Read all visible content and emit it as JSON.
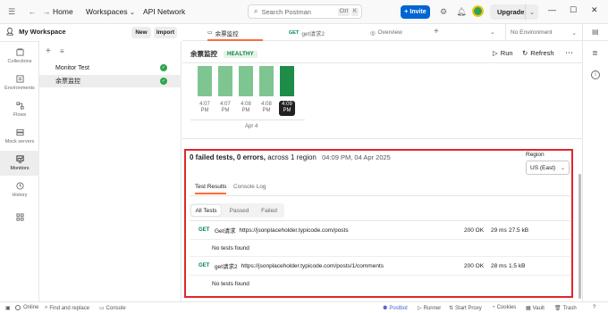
{
  "topbar": {
    "home": "Home",
    "workspaces": "Workspaces",
    "api_network": "API Network",
    "search_placeholder": "Search Postman",
    "kbd1": "Ctrl",
    "kbd2": "K",
    "invite": "Invite",
    "upgrade": "Upgrade"
  },
  "workspace": {
    "name": "My Workspace",
    "new_label": "New",
    "import_label": "Import"
  },
  "rail": {
    "items": [
      {
        "label": "Collections",
        "icon": "collections-icon"
      },
      {
        "label": "Environments",
        "icon": "environments-icon"
      },
      {
        "label": "Flows",
        "icon": "flows-icon"
      },
      {
        "label": "Mock servers",
        "icon": "mock-servers-icon"
      },
      {
        "label": "Monitors",
        "icon": "monitors-icon"
      },
      {
        "label": "History",
        "icon": "history-icon"
      }
    ]
  },
  "monitors": [
    {
      "name": "Monitor Test",
      "status": "passed"
    },
    {
      "name": "余票监控",
      "status": "passed"
    }
  ],
  "tabs": [
    {
      "label": "余票监控",
      "type": "monitor"
    },
    {
      "label": "get请求2",
      "method": "GET"
    },
    {
      "label": "Overview",
      "type": "overview"
    }
  ],
  "environment": "No Environment",
  "monitor": {
    "title": "余票监控",
    "status": "HEALTHY",
    "run": "Run",
    "refresh": "Refresh"
  },
  "chart_data": {
    "type": "bar",
    "categories": [
      "4:07 PM",
      "4:07 PM",
      "4:08 PM",
      "4:08 PM",
      "4:09 PM"
    ],
    "values": [
      1,
      1,
      1,
      1,
      1
    ],
    "highlighted_index": 4,
    "date_label": "Apr 4",
    "colors": {
      "bar": "#7fc592",
      "highlight": "#1e8d48"
    }
  },
  "results": {
    "failed_tests": "0 failed tests,",
    "errors": "0 errors,",
    "regions": "across 1 region",
    "timestamp": "04:09 PM, 04 Apr 2025",
    "region_label": "Region",
    "region_value": "US (East)",
    "subtabs": [
      "Test Results",
      "Console Log"
    ],
    "filters": [
      "All Tests",
      "Passed",
      "Failed"
    ],
    "requests": [
      {
        "method": "GET",
        "name": "Get请求",
        "url": "https://jsonplaceholder.typicode.com/posts",
        "status": "200 OK",
        "time": "29 ms",
        "size": "27.5 kB",
        "tests": "No tests found"
      },
      {
        "method": "GET",
        "name": "get请求2",
        "url": "https://jsonplaceholder.typicode.com/posts/1/comments",
        "status": "200 OK",
        "time": "28 ms",
        "size": "1.5 kB",
        "tests": "No tests found"
      }
    ]
  },
  "statusbar": {
    "online": "Online",
    "find_replace": "Find and replace",
    "console": "Console",
    "postbot": "Postbot",
    "runner": "Runner",
    "start_proxy": "Start Proxy",
    "cookies": "Cookies",
    "vault": "Vault",
    "trash": "Trash"
  }
}
